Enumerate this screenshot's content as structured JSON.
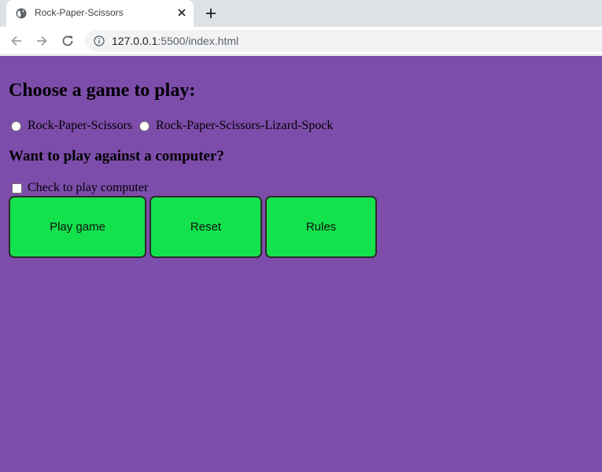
{
  "browser": {
    "tab_title": "Rock-Paper-Scissors",
    "url_host": "127.0.0.1",
    "url_path": ":5500/index.html"
  },
  "page": {
    "background_color": "#7d4dab",
    "heading_game": "Choose a game to play:",
    "game_options": [
      {
        "label": "Rock-Paper-Scissors",
        "selected": false
      },
      {
        "label": "Rock-Paper-Scissors-Lizard-Spock",
        "selected": false
      }
    ],
    "heading_computer": "Want to play against a computer?",
    "computer_checkbox": {
      "label": "Check to play computer",
      "checked": false
    },
    "buttons": {
      "play": "Play game",
      "reset": "Reset",
      "rules": "Rules",
      "color": "#13e24d"
    }
  }
}
